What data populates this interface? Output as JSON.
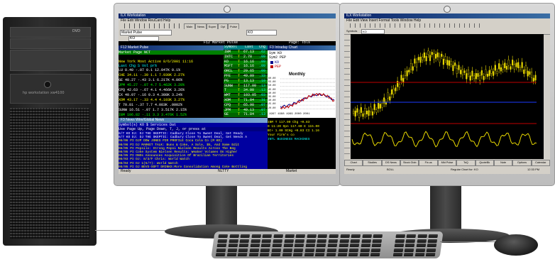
{
  "tower": {
    "badge": "hp workstation xw4100",
    "drive": "DVD"
  },
  "left_monitor": {
    "app_title": "ILX Workstation",
    "menu": "File  Edit  Window  ReuCard  Help",
    "toolbar_buttons": [
      "Main",
      "News",
      "Super",
      "Opt",
      "Pulse"
    ],
    "market_select": "Market Pulse",
    "symbol_value": "KO",
    "market_pulse_header": "F12 Market Pulse",
    "market_pulse_page": "Page: Tbls",
    "f12_title": "F12 Market Pulse",
    "f12_subtitle": "Market Page NCT",
    "most_active_header": "New York Most Active   8/6/2001  11:16",
    "most_active_cols": "     Last  Chg    S    Vol    pr%",
    "most_active_rows": [
      {
        "text": "LU     8.40  -.07  0.1 12.047K  0.1%",
        "color": "#ffffff"
      },
      {
        "text": "CHE   34.11  -.39  1.1  7.930K  2.27%",
        "color": "#ffff00"
      },
      {
        "text": "GE    40.27  -.43  3.1  6.217K  4.06%",
        "color": "#ffffff"
      },
      {
        "text": "JPM   45.27  -.07  4.7  5.462K  3.20%",
        "color": "#00ff00"
      },
      {
        "text": "CPQ   42.63  -.67  4.1  4.466K  3.26%",
        "color": "#ffffff"
      },
      {
        "text": "CX    40.07  -.16  0.3  4.308K  3.24%",
        "color": "#ffffff"
      },
      {
        "text": "XOM   43.17  -.33  4.4  4.103K  3.27%",
        "color": "#ffff00"
      },
      {
        "text": "T     70.81  -.37  7.7  4.083K  .0002%",
        "color": "#ffffff"
      },
      {
        "text": "SUNW  16.51  -.07  1.7  3.517K  2.15%",
        "color": "#ffffff"
      },
      {
        "text": "IBM  106.82  -.11  3.3  3.476K  1.52%",
        "color": "#00ff00"
      }
    ],
    "quote_cols": [
      "Symbol",
      "Last",
      "Chg"
    ],
    "quote_rows": [
      {
        "sym": "IBM",
        "mark": "T",
        "last": "67.13",
        "chg": ".62"
      },
      {
        "sym": "INTC",
        "mark": "T",
        "last": "2.78",
        "chg": ".09"
      },
      {
        "sym": "KO",
        "mark": "T",
        "last": "16.16",
        "chg": ".09"
      },
      {
        "sym": "MSFT",
        "mark": "T",
        "last": "16.16",
        "chg": ".09"
      },
      {
        "sym": "ORCL",
        "mark": "T",
        "last": "29.65",
        "chg": ".09"
      },
      {
        "sym": "PFE",
        "mark": "T",
        "last": "49.09",
        "chg": ".33"
      },
      {
        "sym": "PG",
        "mark": "T",
        "last": "13.13",
        "chg": ".10"
      },
      {
        "sym": "SUNW",
        "mark": "T",
        "last": "117.00",
        "chg": ".13"
      },
      {
        "sym": "T",
        "mark": "T",
        "last": "34.00",
        "chg": ".13"
      },
      {
        "sym": "WMT",
        "mark": "T",
        "last": "103.05",
        "chg": ".03"
      },
      {
        "sym": "XOM",
        "mark": "T",
        "last": "71.84",
        "chg": ".31"
      },
      {
        "sym": "CPQ",
        "mark": "T",
        "last": "65.98",
        "chg": ".07"
      },
      {
        "sym": "JPM",
        "mark": "T",
        "last": "49.13",
        "chg": ".07"
      },
      {
        "sym": "GE",
        "mark": "T",
        "last": "71.84",
        "chg": ".13"
      }
    ],
    "chart_window_title": "F3 Intraday Chart",
    "chart_syms": [
      "Sym KO",
      "Sym2 PEP"
    ],
    "chart_legend": [
      "KO",
      "PEP"
    ],
    "chart_title": "Monthly",
    "chart_axis": "1997  1998  1999  2000  2001",
    "chart_yticks": [
      "60.00",
      "55.00",
      "50.00",
      "45.00",
      "40.00",
      "35.00",
      "30.00",
      "25.00",
      "20.00"
    ],
    "news_title": "F3 News Wire/Global News",
    "news_header": "Symbol(s) KO        $       Services   Dat",
    "news_subheader": "Use Page Up, Page Down, T, J, or press at",
    "news_lines": [
      "8/7 KO DJ: DJ THE SKEPTIC: Cadbury Close To Sweet Deal, Get Ready",
      "8/7 KO DJ: DJ THE SKEPTIC: Cadbury Close To Sweet Deal, Get Needs A",
      "08/06 PI DJP DOW JONES PIR PROFILE Coca Cola Co (M KO)",
      "08/06 PI DJ MARKET TALK: Buns & Coke, A Sole, $5, And Some Edit",
      "08/05 PI Pepsilo: Strong Pepsi Nielsen Results Across The Beg",
      "08/05 PI Coke System Nielsen Results: Weaker Volumes On Higher",
      "08/05 PI DNOs Announces Acquisition Of Brazilian Territories",
      "08/03 PI DJ: 8/3/F Chris: World Watch",
      "08/04 PI DJ 1(5/?): World Watch",
      "08/05 PI DJ BEVS-SOFT DRINKS:More Consolidation Among Coke Bottling"
    ],
    "quote_panel": [
      "IBM       T    117.00 Chg  +0.83",
      "0   11:20 Opn    117.60 E  115.00",
      "Bt+ 1.00 SCHg  +0.83 CI    1.16",
      "                Your Firm's co",
      "      INTL BUSINESS MACHINES"
    ],
    "status_left": "Ready",
    "status_mid": "NLTTY",
    "status_right": "Market"
  },
  "right_monitor": {
    "app_title": "ILX Workstation",
    "menu": "File  Edit  View  Insert  Format  Tools  Window  Help",
    "symbol_label": "Symbols",
    "symbol_value": "KO",
    "tabs": [
      "Chart",
      "Studies",
      "DS News",
      "Stock Glob",
      "Fix.us",
      "Mkt Pulse",
      "TsQ",
      "QuoteBk",
      "Note",
      "Options",
      "Calendar"
    ],
    "status_left": "Ready",
    "status_mid": "BOLL",
    "status_right": "Regular Chart for: KO",
    "time": "12:33 PM"
  },
  "colors": {
    "terminal_bg": "#000000",
    "terminal_blue": "#0000a0",
    "title_blue": "#0a246a",
    "quote_green": "#00c000",
    "candle_yellow": "#e8d800",
    "chart_red": "#c00000",
    "chart_navy": "#00008b"
  }
}
